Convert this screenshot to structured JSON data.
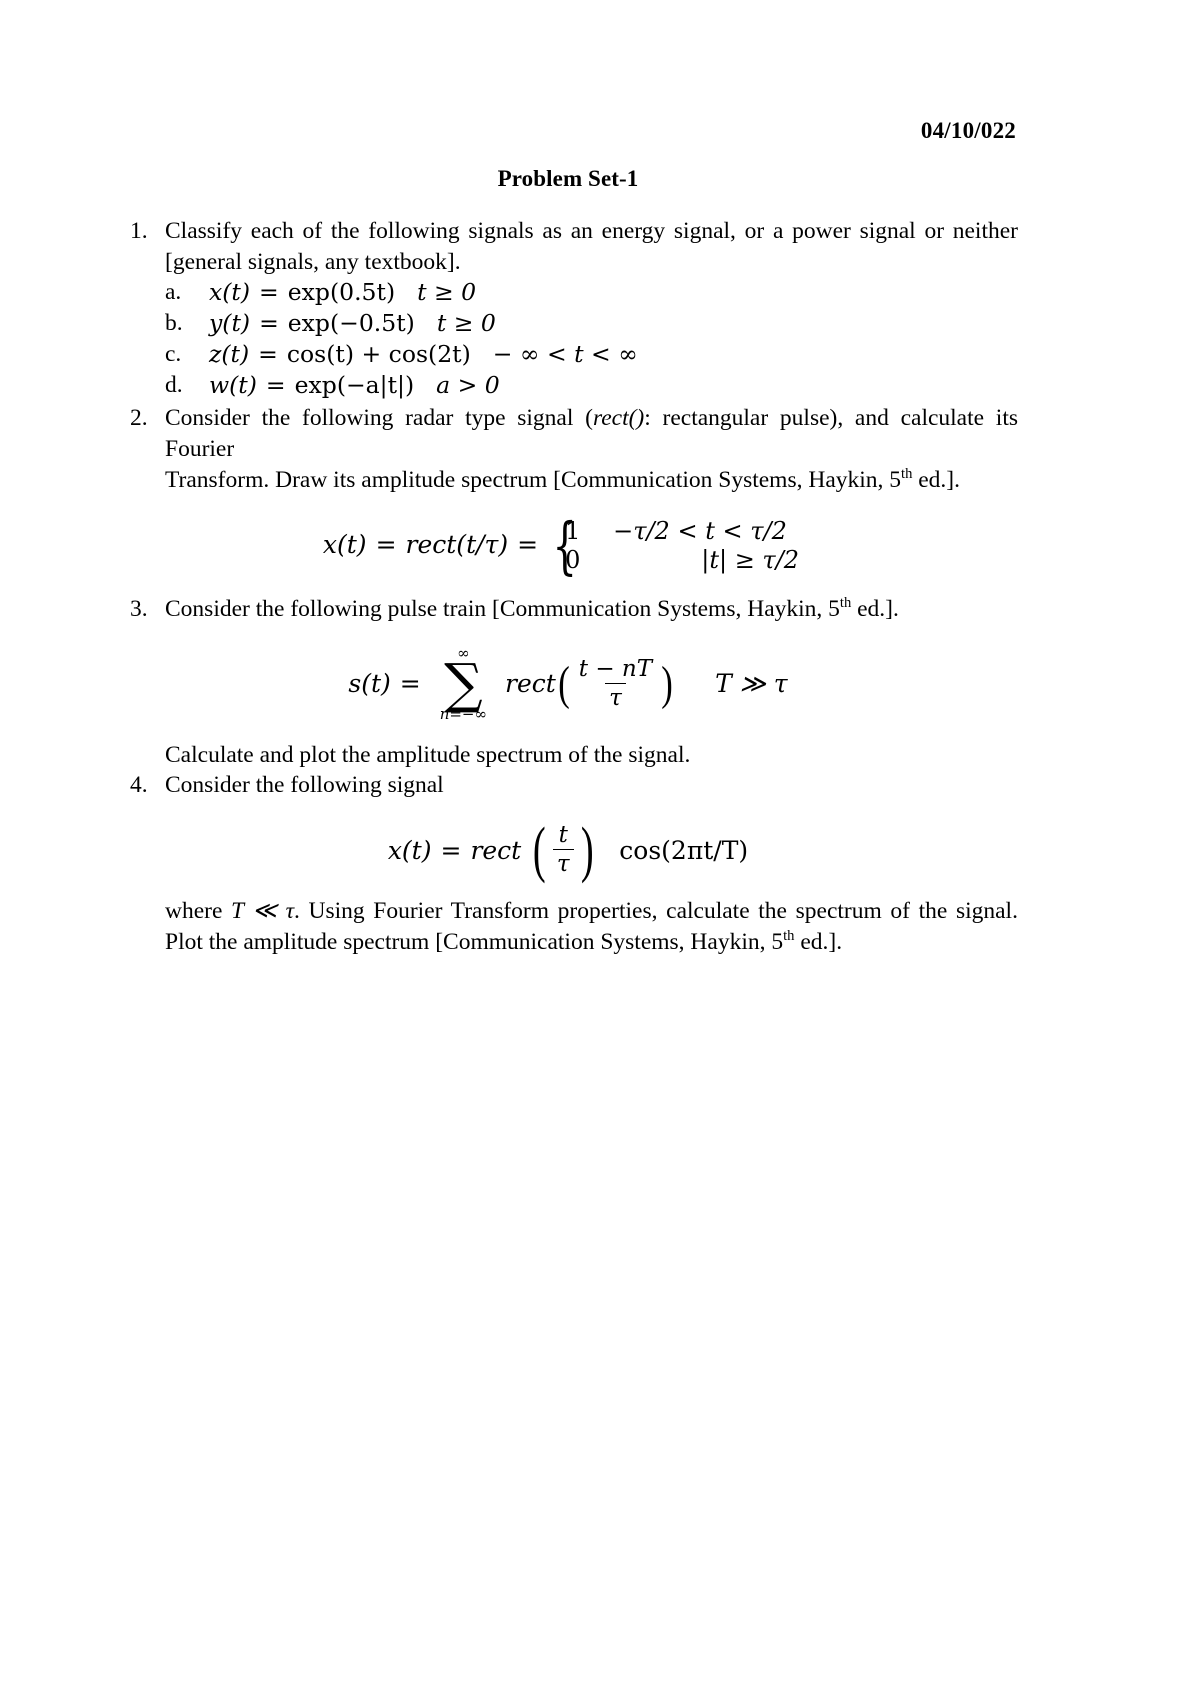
{
  "document": {
    "date": "04/10/022",
    "title": "Problem Set-1"
  },
  "problems": [
    {
      "number": "1.",
      "text": "Classify each of the following signals as an energy signal, or a power signal or neither [general signals, any textbook].",
      "text_line1": "Classify each of the following signals as an energy signal, or a power signal or neither",
      "text_line2": "[general signals, any textbook].",
      "subitems": [
        {
          "label": "a.",
          "lhs": "x(t)",
          "eq": "=",
          "rhs": "exp(0.5t)",
          "condition": "t ≥ 0"
        },
        {
          "label": "b.",
          "lhs": "y(t)",
          "eq": "=",
          "rhs": "exp(−0.5t)",
          "condition": "t ≥ 0"
        },
        {
          "label": "c.",
          "lhs": "z(t)",
          "eq": "=",
          "rhs": "cos(t) + cos(2t)",
          "condition": "− ∞ < t < ∞"
        },
        {
          "label": "d.",
          "lhs": "w(t)",
          "eq": "=",
          "rhs": "exp(−a|t|)",
          "condition": "a > 0"
        }
      ]
    },
    {
      "number": "2.",
      "line1_pre": "Consider the following radar type signal (",
      "line1_italic": "rect()",
      "line1_post": ": rectangular pulse), and calculate its Fourier",
      "line2_pre": "Transform. Draw its amplitude spectrum [Communication Systems, Haykin, 5",
      "line2_sup": "th",
      "line2_post": " ed.].",
      "equation": {
        "lhs": "x(t)",
        "eq1": "=",
        "mid": "rect(t/τ)",
        "eq2": "=",
        "case1_value": "1",
        "case1_cond": "−τ/2 < t < τ/2",
        "case2_value": "0",
        "case2_cond": "|t| ≥ τ/2"
      }
    },
    {
      "number": "3.",
      "line1_pre": "Consider the following pulse train [Communication Systems, Haykin, 5",
      "line1_sup": "th",
      "line1_post": " ed.].",
      "equation": {
        "lhs": "s(t)",
        "eq": "=",
        "sum_upper": "∞",
        "sum_symbol": "∑",
        "sum_lower": "n=−∞",
        "func": "rect",
        "numerator": "t − nT",
        "denominator": "τ",
        "condition": "T ≫ τ"
      },
      "followup": "Calculate and plot the amplitude spectrum of the signal."
    },
    {
      "number": "4.",
      "line1": "Consider the following signal",
      "equation": {
        "lhs": "x(t)",
        "eq": "=",
        "func": "rect",
        "numerator": "t",
        "denominator": "τ",
        "trailing": "cos(2πt/T)"
      },
      "closing_line1_pre": "where ",
      "closing_line1_math": "T ≪ τ",
      "closing_line1_post": ". Using Fourier Transform properties, calculate the spectrum of the signal.",
      "closing_line2_pre": "Plot the amplitude spectrum [Communication Systems, Haykin, 5",
      "closing_line2_sup": "th",
      "closing_line2_post": " ed.]."
    }
  ]
}
